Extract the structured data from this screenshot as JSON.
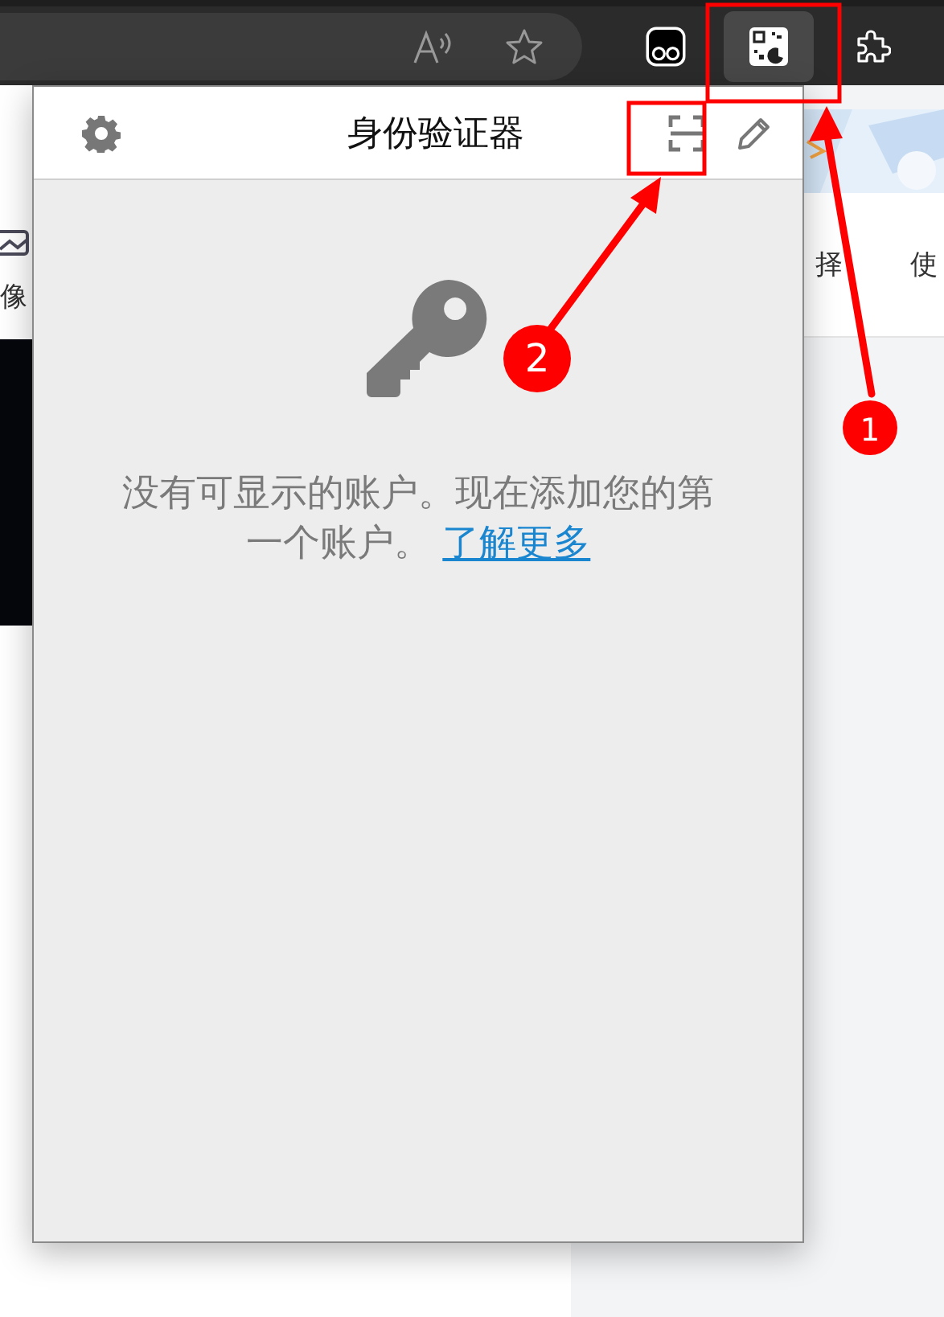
{
  "toolbar": {
    "address_icons": [
      {
        "kind": "read-aloud"
      },
      {
        "kind": "favorite"
      }
    ],
    "extensions": [
      {
        "kind": "mask",
        "selected": false
      },
      {
        "kind": "qr",
        "selected": true
      },
      {
        "kind": "puzzle",
        "selected": false
      }
    ]
  },
  "background": {
    "left_label": "像",
    "right_labels": [
      "择",
      "使"
    ]
  },
  "popup": {
    "title": "身份验证器",
    "message": "没有可显示的账户。现在添加您的第一个账户。",
    "link": "了解更多"
  },
  "annotations": [
    {
      "label": "1"
    },
    {
      "label": "2"
    }
  ]
}
